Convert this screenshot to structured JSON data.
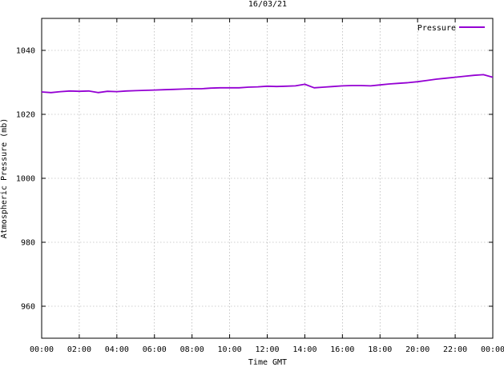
{
  "chart_data": {
    "type": "line",
    "title": "16/03/21",
    "xlabel": "Time GMT",
    "ylabel": "Atmospheric Pressure (mb)",
    "x_ticks": [
      "00:00",
      "02:00",
      "04:00",
      "06:00",
      "08:00",
      "10:00",
      "12:00",
      "14:00",
      "16:00",
      "18:00",
      "20:00",
      "22:00",
      "00:00"
    ],
    "x_range_hours": [
      0,
      24
    ],
    "y_ticks": [
      960,
      980,
      1000,
      1020,
      1040
    ],
    "ylim": [
      950,
      1050
    ],
    "grid": true,
    "legend_position": "top-right",
    "series": [
      {
        "name": "Pressure",
        "color": "#9400d3",
        "x_hours": [
          0,
          0.5,
          1,
          1.5,
          2,
          2.5,
          3,
          3.5,
          4,
          4.5,
          5,
          5.5,
          6,
          6.5,
          7,
          7.5,
          8,
          8.5,
          9,
          9.5,
          10,
          10.5,
          11,
          11.5,
          12,
          12.5,
          13,
          13.5,
          14,
          14.5,
          15,
          15.5,
          16,
          16.5,
          17,
          17.5,
          18,
          18.5,
          19,
          19.5,
          20,
          20.5,
          21,
          21.5,
          22,
          22.5,
          23,
          23.5,
          24
        ],
        "values": [
          1027,
          1026.8,
          1027.1,
          1027.3,
          1027.2,
          1027.3,
          1026.8,
          1027.2,
          1027.1,
          1027.3,
          1027.4,
          1027.5,
          1027.6,
          1027.7,
          1027.8,
          1027.9,
          1028,
          1028,
          1028.2,
          1028.3,
          1028.3,
          1028.3,
          1028.5,
          1028.6,
          1028.8,
          1028.7,
          1028.8,
          1028.9,
          1029.4,
          1028.3,
          1028.5,
          1028.7,
          1028.9,
          1029,
          1029,
          1028.9,
          1029.2,
          1029.5,
          1029.7,
          1029.9,
          1030.2,
          1030.6,
          1031,
          1031.3,
          1031.6,
          1031.9,
          1032.2,
          1032.4,
          1031.6
        ]
      }
    ]
  }
}
